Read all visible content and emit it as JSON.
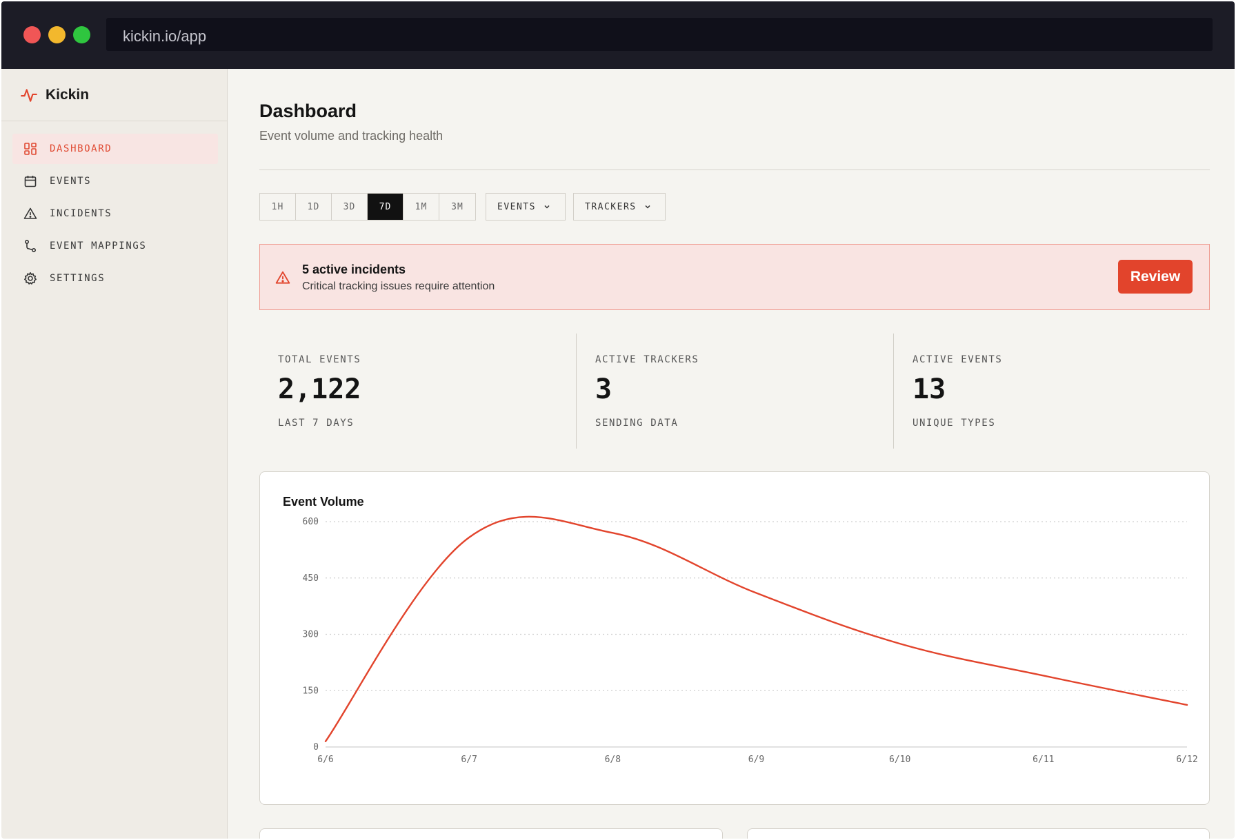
{
  "browser": {
    "url": "kickin.io/app"
  },
  "sidebar": {
    "brand": "Kickin",
    "items": [
      {
        "label": "DASHBOARD",
        "icon": "dashboard-icon",
        "active": true
      },
      {
        "label": "EVENTS",
        "icon": "calendar-icon",
        "active": false
      },
      {
        "label": "INCIDENTS",
        "icon": "alert-triangle-icon",
        "active": false
      },
      {
        "label": "EVENT MAPPINGS",
        "icon": "route-icon",
        "active": false
      },
      {
        "label": "SETTINGS",
        "icon": "gear-icon",
        "active": false
      }
    ]
  },
  "header": {
    "title": "Dashboard",
    "subtitle": "Event volume and tracking health"
  },
  "filters": {
    "ranges": [
      "1H",
      "1D",
      "3D",
      "7D",
      "1M",
      "3M"
    ],
    "active_range": "7D",
    "events_label": "EVENTS",
    "trackers_label": "TRACKERS"
  },
  "alert": {
    "title": "5 active incidents",
    "subtitle": "Critical tracking issues require attention",
    "button": "Review"
  },
  "stats": [
    {
      "label": "TOTAL EVENTS",
      "value": "2,122",
      "foot": "LAST 7 DAYS"
    },
    {
      "label": "ACTIVE TRACKERS",
      "value": "3",
      "foot": "SENDING DATA"
    },
    {
      "label": "ACTIVE EVENTS",
      "value": "13",
      "foot": "UNIQUE TYPES"
    }
  ],
  "colors": {
    "accent": "#e2442c",
    "alert_bg": "#f9e4e2"
  },
  "chart_data": {
    "type": "line",
    "title": "Event Volume",
    "x": [
      "6/6",
      "6/7",
      "6/8",
      "6/9",
      "6/10",
      "6/11",
      "6/12"
    ],
    "series": [
      {
        "values": [
          15,
          558,
          570,
          410,
          275,
          190,
          112
        ]
      }
    ],
    "yticks": [
      0,
      150,
      300,
      450,
      600
    ],
    "ylim": [
      0,
      600
    ],
    "grid": true,
    "line_color": "#e2442c"
  }
}
